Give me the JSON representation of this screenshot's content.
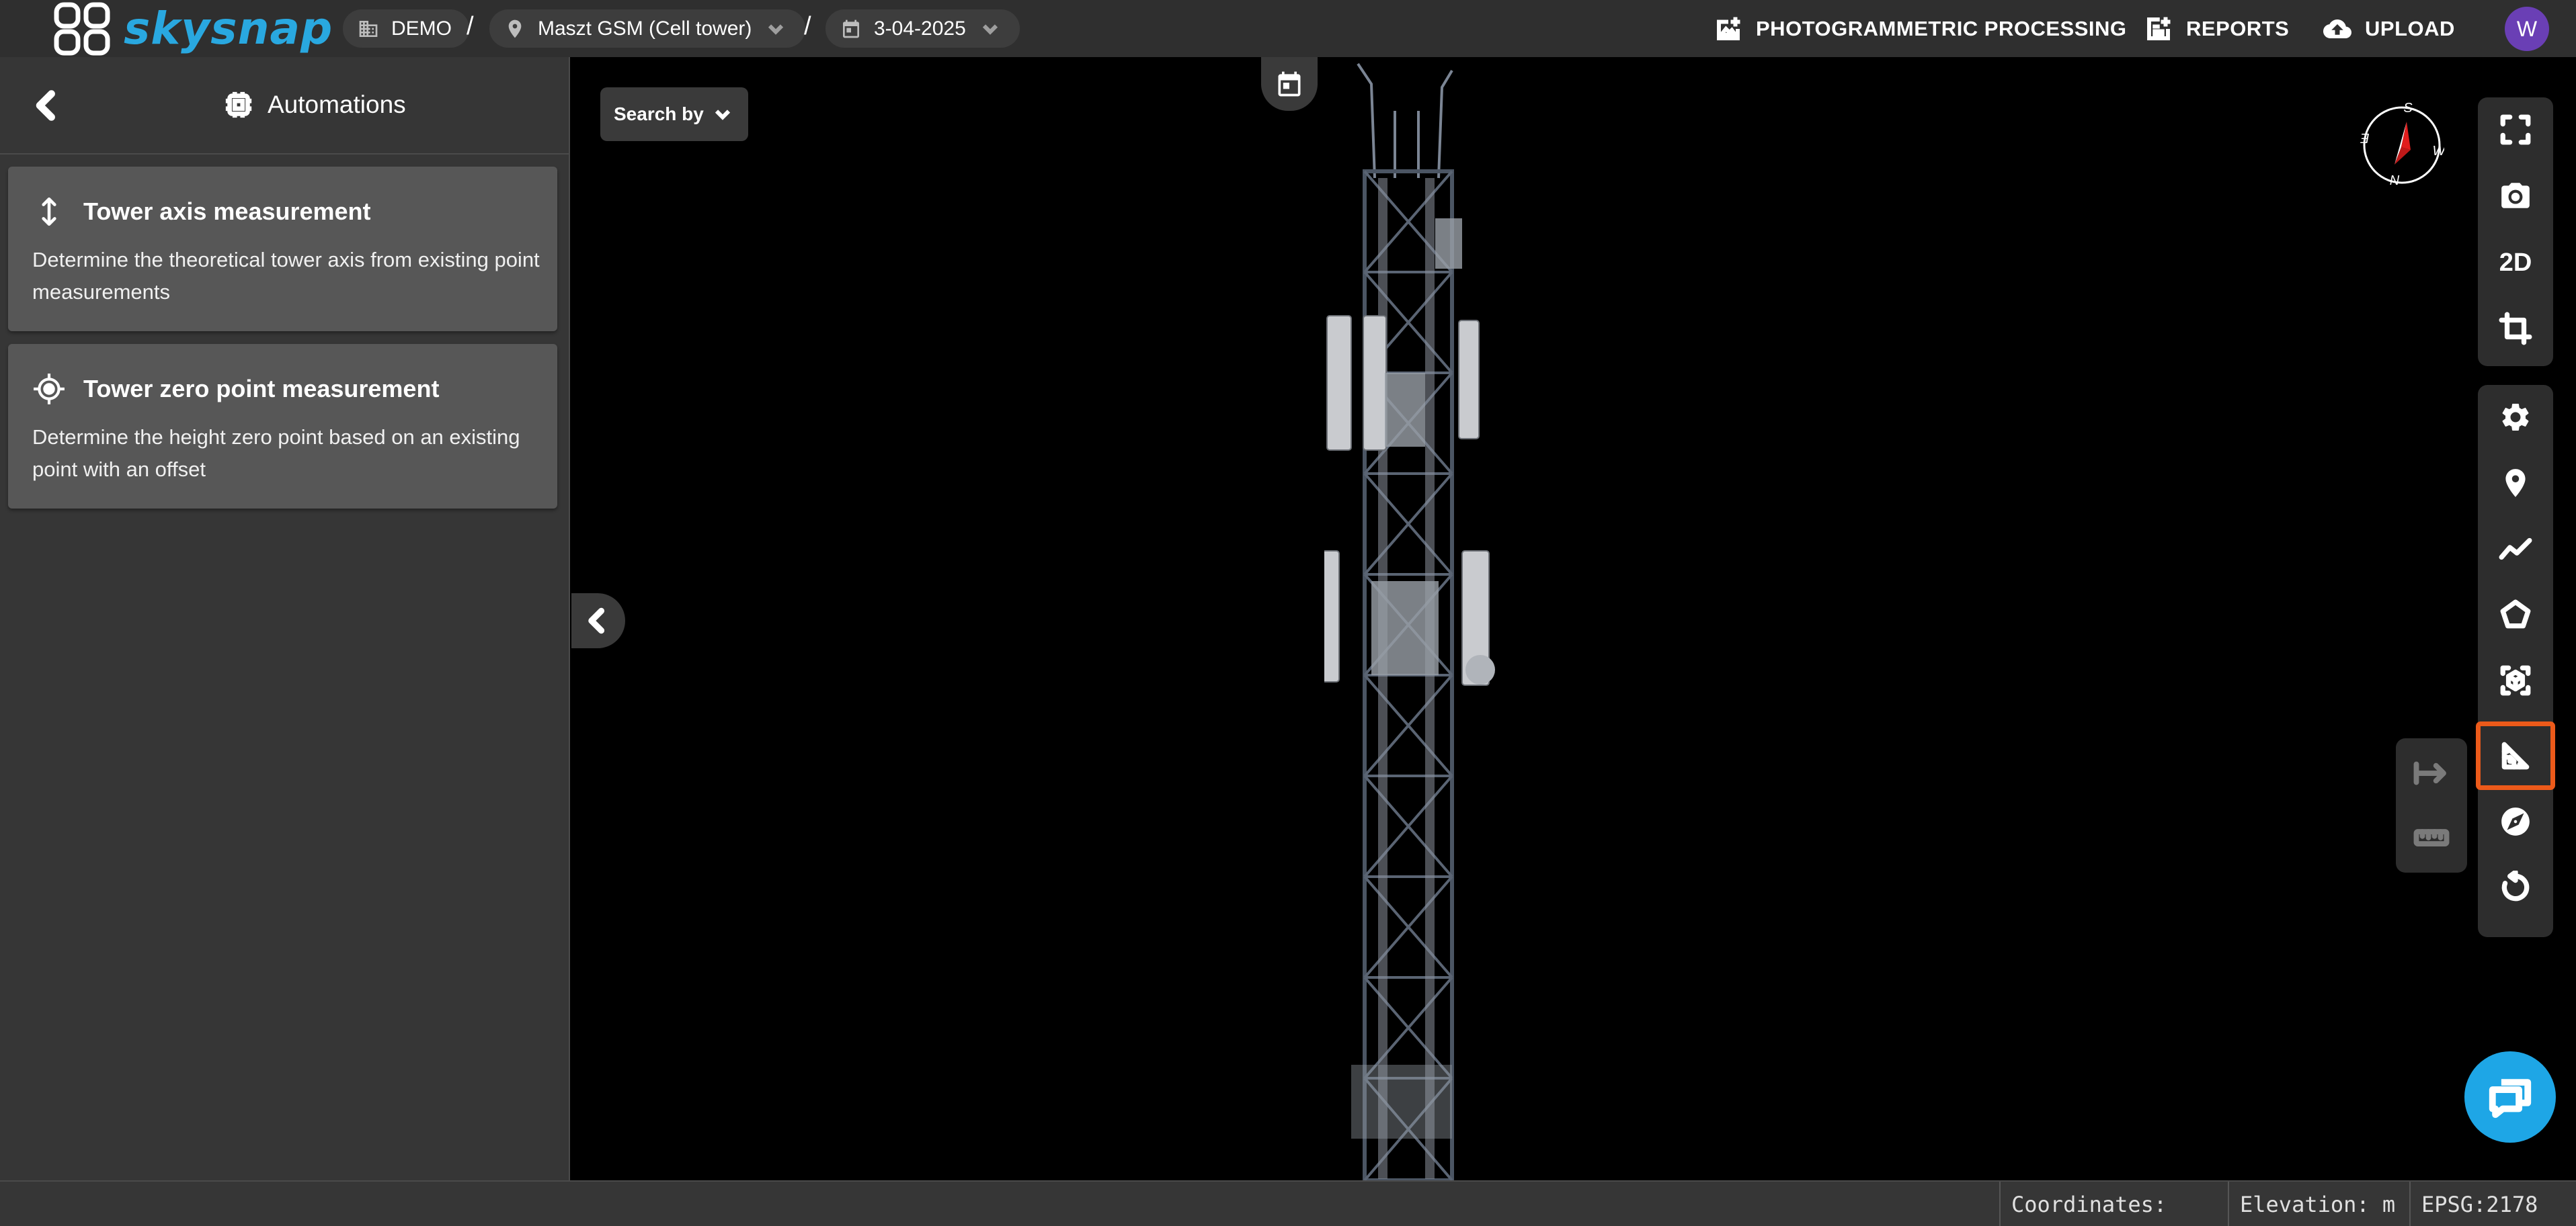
{
  "app": {
    "brand": "skysnap"
  },
  "breadcrumb": {
    "organization": "DEMO",
    "site": "Maszt GSM (Cell tower)",
    "date": "3-04-2025",
    "separator": "/"
  },
  "header_actions": {
    "photogrammetric": "PHOTOGRAMMETRIC PROCESSING",
    "reports": "REPORTS",
    "upload": "UPLOAD",
    "avatar_initial": "W"
  },
  "panel": {
    "title": "Automations",
    "cards": [
      {
        "title": "Tower axis measurement",
        "description": "Determine the theoretical tower axis from existing point measurements",
        "icon": "vertical-arrows-icon"
      },
      {
        "title": "Tower zero point measurement",
        "description": "Determine the height zero point based on an existing point with an offset",
        "icon": "crosshair-icon"
      }
    ]
  },
  "viewer": {
    "search_by": "Search by",
    "compass": {
      "n": "N",
      "s": "S",
      "e": "E",
      "w": "W"
    }
  },
  "toolbar": {
    "view_2d": "2D",
    "tools": [
      "fullscreen-icon",
      "camera-icon",
      "2d-toggle",
      "crop-icon",
      "gear-icon",
      "map-pin-icon",
      "polyline-icon",
      "polygon-icon",
      "cube-icon",
      "set-square-icon",
      "compass-icon",
      "reset-rotation-icon"
    ],
    "active_tool": "set-square-icon",
    "accent_color": "#ec5a1a"
  },
  "statusbar": {
    "coordinates": "Coordinates:",
    "elevation": "Elevation: m",
    "epsg": "EPSG:2178"
  },
  "colors": {
    "brand": "#29a8e0",
    "chat": "#1ea6e6",
    "avatar": "#6a3fb5"
  }
}
